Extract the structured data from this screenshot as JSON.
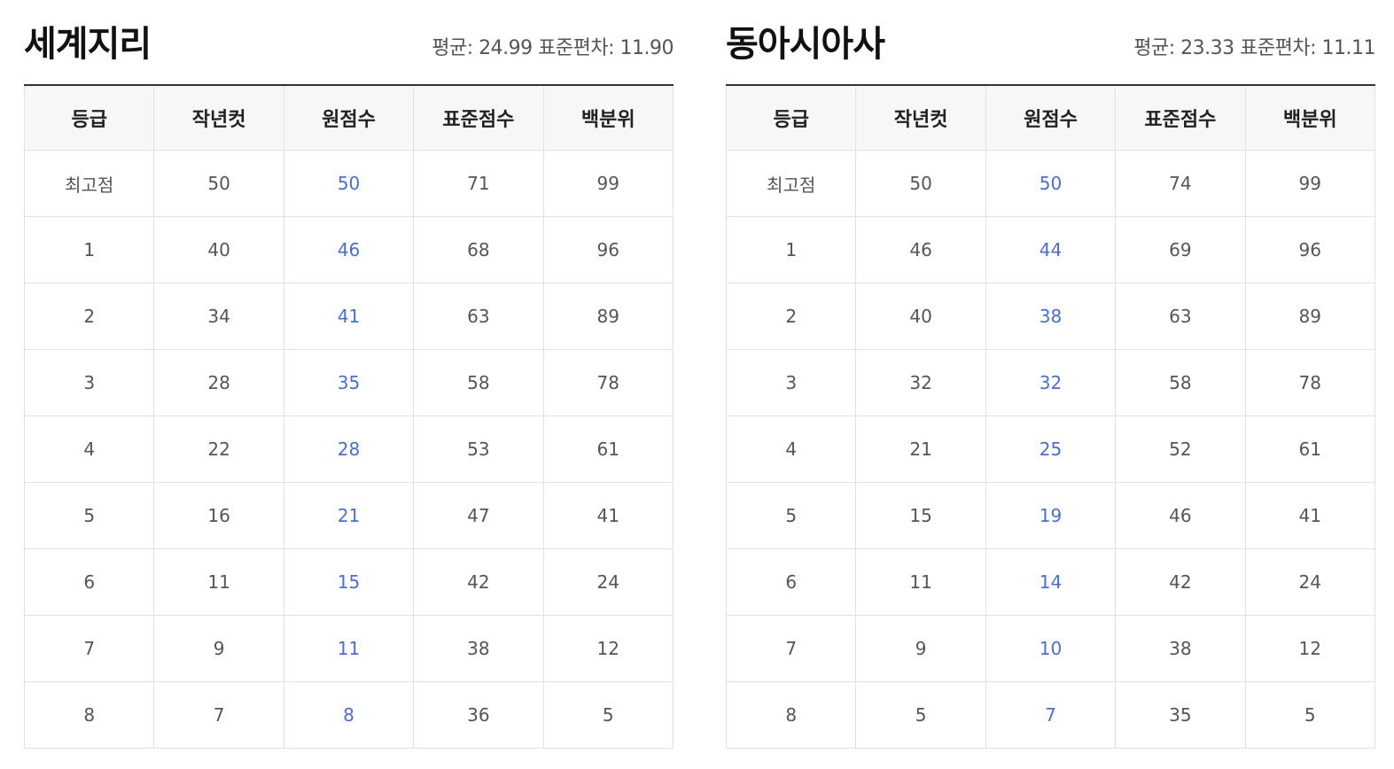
{
  "columns": [
    "등급",
    "작년컷",
    "원점수",
    "표준점수",
    "백분위"
  ],
  "colors": {
    "raw_score": "#4a6fc7",
    "header_bg": "#f7f7f7",
    "top_border": "#333333",
    "grid": "#e1e1e1"
  },
  "panels": [
    {
      "title": "세계지리",
      "mean_label": "평균: 24.99",
      "stdev_label": "표준편차: 11.90",
      "rows": [
        [
          "최고점",
          "50",
          "50",
          "71",
          "99"
        ],
        [
          "1",
          "40",
          "46",
          "68",
          "96"
        ],
        [
          "2",
          "34",
          "41",
          "63",
          "89"
        ],
        [
          "3",
          "28",
          "35",
          "58",
          "78"
        ],
        [
          "4",
          "22",
          "28",
          "53",
          "61"
        ],
        [
          "5",
          "16",
          "21",
          "47",
          "41"
        ],
        [
          "6",
          "11",
          "15",
          "42",
          "24"
        ],
        [
          "7",
          "9",
          "11",
          "38",
          "12"
        ],
        [
          "8",
          "7",
          "8",
          "36",
          "5"
        ]
      ]
    },
    {
      "title": "동아시아사",
      "mean_label": "평균: 23.33",
      "stdev_label": "표준편차: 11.11",
      "rows": [
        [
          "최고점",
          "50",
          "50",
          "74",
          "99"
        ],
        [
          "1",
          "46",
          "44",
          "69",
          "96"
        ],
        [
          "2",
          "40",
          "38",
          "63",
          "89"
        ],
        [
          "3",
          "32",
          "32",
          "58",
          "78"
        ],
        [
          "4",
          "21",
          "25",
          "52",
          "61"
        ],
        [
          "5",
          "15",
          "19",
          "46",
          "41"
        ],
        [
          "6",
          "11",
          "14",
          "42",
          "24"
        ],
        [
          "7",
          "9",
          "10",
          "38",
          "12"
        ],
        [
          "8",
          "5",
          "7",
          "35",
          "5"
        ]
      ]
    }
  ]
}
